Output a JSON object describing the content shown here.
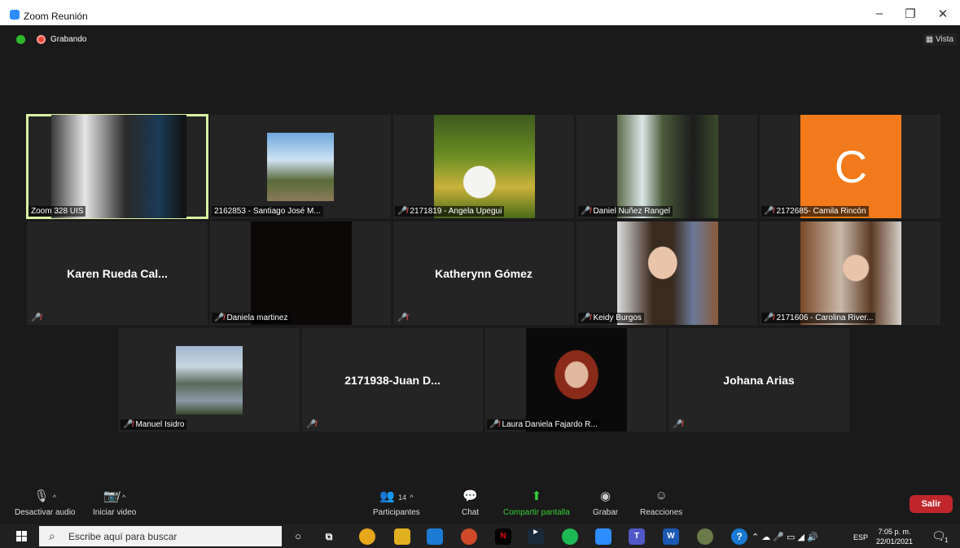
{
  "window": {
    "title": "Zoom Reunión",
    "minimize": "–",
    "restore": "❐",
    "close": "✕"
  },
  "top": {
    "recording_label": "Grabando",
    "view_label": "Vista"
  },
  "tiles": [
    {
      "name": "Zoom 328 UIS"
    },
    {
      "name": "2162853 - Santiago José M..."
    },
    {
      "name": "2171819 - Angela Upegui"
    },
    {
      "name": "Daniel Nuñez Rangel"
    },
    {
      "name": "2172685- Camila Rincón",
      "avatar_letter": "C"
    },
    {
      "big": "Karen Rueda Cal..."
    },
    {
      "name": "Daniela martinez"
    },
    {
      "big": "Katherynn Gómez"
    },
    {
      "name": "Keidy Burgos"
    },
    {
      "name": "2171606 - Carolina River..."
    },
    {
      "name": "Manuel Isidro"
    },
    {
      "big": "2171938-Juan D..."
    },
    {
      "name": "Laura Daniela Fajardo R..."
    },
    {
      "big": "Johana Arias"
    }
  ],
  "toolbar": {
    "audio": "Desactivar audio",
    "video": "Iniciar video",
    "participants": "Participantes",
    "participants_count": "14",
    "chat": "Chat",
    "share": "Compartir pantalla",
    "record": "Grabar",
    "reactions": "Reacciones",
    "leave": "Salir"
  },
  "taskbar": {
    "search_placeholder": "Escribe aquí para buscar",
    "language": "ESP",
    "time": "7:05 p. m.",
    "date": "22/01/2021",
    "notifications": "1"
  },
  "colors": {
    "accent_green": "#35d135",
    "leave_red": "#c0262c",
    "avatar_orange": "#f27a1a",
    "active_outline": "#d9f2a0"
  }
}
